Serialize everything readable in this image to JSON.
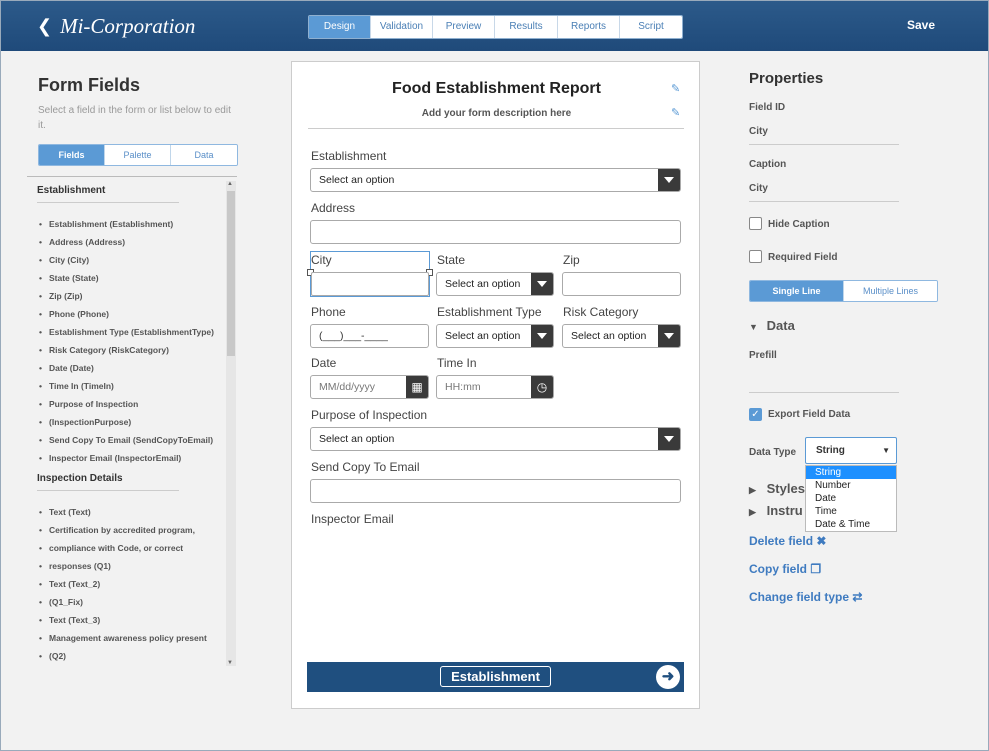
{
  "header": {
    "brand": "Mi-Corporation",
    "tabs": [
      "Design",
      "Validation",
      "Preview",
      "Results",
      "Reports",
      "Script"
    ],
    "active_tab": "Design",
    "save_label": "Save"
  },
  "left": {
    "title": "Form Fields",
    "hint": "Select a field in the form or list below to edit it.",
    "view_tabs": [
      "Fields",
      "Palette",
      "Data"
    ],
    "groups": [
      {
        "name": "Establishment",
        "items": [
          "Establishment (Establishment)",
          "Address (Address)",
          "City (City)",
          "State (State)",
          "Zip (Zip)",
          "Phone (Phone)",
          "Establishment Type (EstablishmentType)",
          "Risk Category (RiskCategory)",
          "Date (Date)",
          "Time In (TimeIn)",
          "Purpose of Inspection",
          "(InspectionPurpose)",
          "Send Copy To Email (SendCopyToEmail)",
          "Inspector Email (InspectorEmail)"
        ]
      },
      {
        "name": "Inspection Details",
        "items": [
          "Text (Text)",
          "Certification by accredited program,",
          "compliance with Code, or correct",
          "responses (Q1)",
          "Text (Text_2)",
          "(Q1_Fix)",
          "Text (Text_3)",
          "Management awareness policy present",
          "(Q2)"
        ]
      }
    ]
  },
  "form": {
    "title": "Food Establishment Report",
    "description": "Add your form description here",
    "fields": {
      "establishment_label": "Establishment",
      "establishment_value": "Select an option",
      "address_label": "Address",
      "city_label": "City",
      "state_label": "State",
      "state_value": "Select an option",
      "zip_label": "Zip",
      "phone_label": "Phone",
      "phone_value": "(___)___-____",
      "estab_type_label": "Establishment Type",
      "estab_type_value": "Select an option",
      "risk_label": "Risk Category",
      "risk_value": "Select an option",
      "date_label": "Date",
      "date_placeholder": "MM/dd/yyyy",
      "timein_label": "Time In",
      "timein_placeholder": "HH:mm",
      "purpose_label": "Purpose of Inspection",
      "purpose_value": "Select an option",
      "sendcopy_label": "Send Copy To Email",
      "inspector_label": "Inspector Email"
    },
    "nav_button": "Establishment"
  },
  "properties": {
    "title": "Properties",
    "field_id_label": "Field ID",
    "field_id_value": "City",
    "caption_label": "Caption",
    "caption_value": "City",
    "hide_caption": "Hide Caption",
    "required_field": "Required Field",
    "line_modes": [
      "Single Line",
      "Multiple Lines"
    ],
    "data_section": "Data",
    "prefill_label": "Prefill",
    "export_label": "Export Field Data",
    "data_type_label": "Data Type",
    "data_type_value": "String",
    "data_type_options": [
      "String",
      "Number",
      "Date",
      "Time",
      "Date & Time"
    ],
    "styles_section": "Styles",
    "instructions_section": "Instru",
    "delete_link": "Delete field",
    "copy_link": "Copy field",
    "change_link": "Change field type"
  },
  "colors": {
    "header_bg": "#1f4a7a",
    "accent": "#5b9ad5",
    "link": "#3f7bc0"
  }
}
